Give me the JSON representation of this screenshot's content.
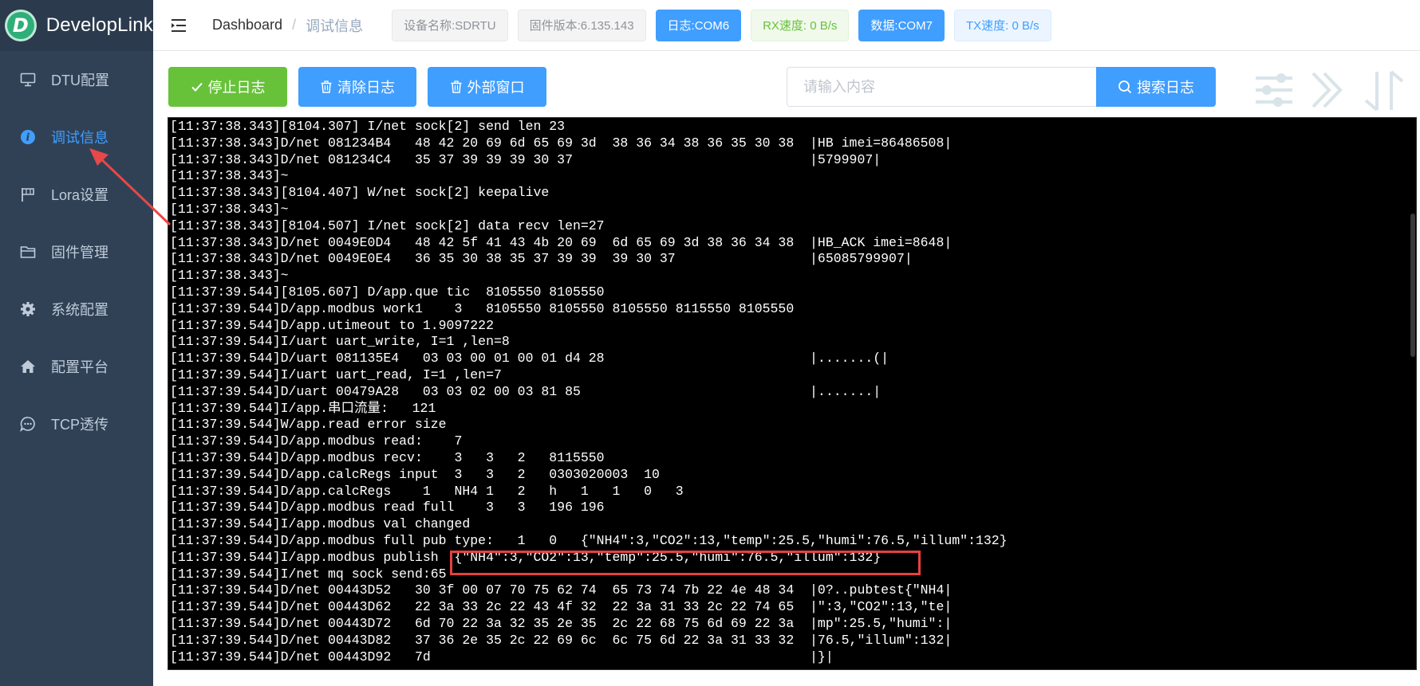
{
  "brand": {
    "logo_letter": "D",
    "name": "DevelopLink"
  },
  "sidebar": {
    "items": [
      {
        "label": "DTU配置",
        "icon": "monitor-icon",
        "active": false
      },
      {
        "label": "调试信息",
        "icon": "info-icon",
        "active": true
      },
      {
        "label": "Lora设置",
        "icon": "flag-icon",
        "active": false
      },
      {
        "label": "固件管理",
        "icon": "folder-icon",
        "active": false
      },
      {
        "label": "系统配置",
        "icon": "gear-icon",
        "active": false
      },
      {
        "label": "配置平台",
        "icon": "home-icon",
        "active": false
      },
      {
        "label": "TCP透传",
        "icon": "chat-icon",
        "active": false
      }
    ]
  },
  "header": {
    "breadcrumb": {
      "home": "Dashboard",
      "separator": "/",
      "current": "调试信息"
    },
    "tags": {
      "device_name": "设备名称:SDRTU",
      "firmware": "固件版本:6.135.143",
      "log_port": "日志:COM6",
      "rx_speed": "RX速度: 0 B/s",
      "data_port": "数据:COM7",
      "tx_speed": "TX速度: 0 B/s"
    }
  },
  "toolbar": {
    "stop_label": "停止日志",
    "clear_label": "清除日志",
    "external_label": "外部窗口",
    "search_placeholder": "请输入内容",
    "search_value": "",
    "search_label": "搜索日志"
  },
  "console": {
    "lines": [
      "[11:37:38.343][8104.307] I/net sock[2] send len 23",
      "[11:37:38.343]D/net 081234B4   48 42 20 69 6d 65 69 3d  38 36 34 38 36 35 30 38  |HB imei=86486508|",
      "[11:37:38.343]D/net 081234C4   35 37 39 39 39 30 37                              |5799907|",
      "[11:37:38.343]~",
      "[11:37:38.343][8104.407] W/net sock[2] keepalive",
      "[11:37:38.343]~",
      "[11:37:38.343][8104.507] I/net sock[2] data recv len=27",
      "[11:37:38.343]D/net 0049E0D4   48 42 5f 41 43 4b 20 69  6d 65 69 3d 38 36 34 38  |HB_ACK imei=8648|",
      "[11:37:38.343]D/net 0049E0E4   36 35 30 38 35 37 39 39  39 30 37                 |65085799907|",
      "[11:37:38.343]~",
      "[11:37:39.544][8105.607] D/app.que tic  8105550 8105550",
      "[11:37:39.544]D/app.modbus work1    3   8105550 8105550 8105550 8115550 8105550",
      "[11:37:39.544]D/app.utimeout to 1.9097222",
      "[11:37:39.544]I/uart uart_write, I=1 ,len=8",
      "[11:37:39.544]D/uart 081135E4   03 03 00 01 00 01 d4 28                          |.......(|",
      "[11:37:39.544]I/uart uart_read, I=1 ,len=7",
      "[11:37:39.544]D/uart 00479A28   03 03 02 00 03 81 85                             |.......|",
      "[11:37:39.544]I/app.串口流量:   121",
      "[11:37:39.544]W/app.read error size",
      "[11:37:39.544]D/app.modbus read:    7",
      "[11:37:39.544]D/app.modbus recv:    3   3   2   8115550",
      "[11:37:39.544]D/app.calcRegs input  3   3   2   0303020003  10",
      "[11:37:39.544]D/app.calcRegs    1   NH4 1   2   h   1   1   0   3",
      "[11:37:39.544]D/app.modbus read full    3   3   196 196",
      "[11:37:39.544]I/app.modbus val changed",
      "[11:37:39.544]D/app.modbus full pub type:   1   0   {\"NH4\":3,\"CO2\":13,\"temp\":25.5,\"humi\":76.5,\"illum\":132}",
      "[11:37:39.544]I/app.modbus publish  {\"NH4\":3,\"CO2\":13,\"temp\":25.5,\"humi\":76.5,\"illum\":132}",
      "[11:37:39.544]I/net mq sock send:65",
      "[11:37:39.544]D/net 00443D52   30 3f 00 07 70 75 62 74  65 73 74 7b 22 4e 48 34  |0?..pubtest{\"NH4|",
      "[11:37:39.544]D/net 00443D62   22 3a 33 2c 22 43 4f 32  22 3a 31 33 2c 22 74 65  |\":3,\"CO2\":13,\"te|",
      "[11:37:39.544]D/net 00443D72   6d 70 22 3a 32 35 2e 35  2c 22 68 75 6d 69 22 3a  |mp\":25.5,\"humi\":|",
      "[11:37:39.544]D/net 00443D82   37 36 2e 35 2c 22 69 6c  6c 75 6d 22 3a 31 33 32  |76.5,\"illum\":132|",
      "[11:37:39.544]D/net 00443D92   7d                                                |}|"
    ]
  },
  "colors": {
    "sidebar_bg": "#304156",
    "accent_blue": "#409eff",
    "success_green": "#67c23a",
    "highlight_red": "#e84040"
  }
}
